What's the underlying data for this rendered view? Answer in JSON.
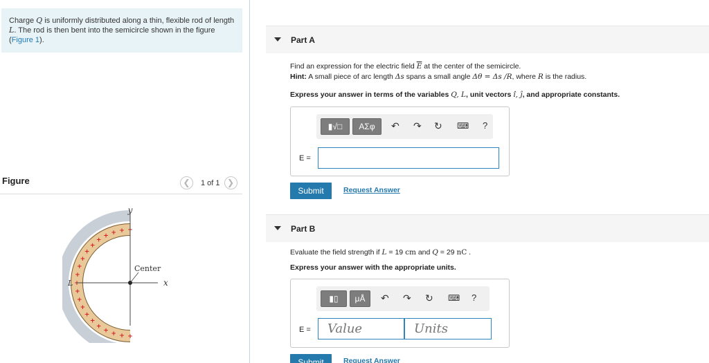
{
  "problem": {
    "intro_pre": "Charge ",
    "intro_Q": "Q",
    "intro_mid1": " is uniformly distributed along a thin, flexible rod of length ",
    "intro_L": "L",
    "intro_mid2": ". The rod is then bent into the semicircle shown in the figure (",
    "intro_link": "Figure 1",
    "intro_post": ")."
  },
  "figure": {
    "title": "Figure",
    "counter": "1 of 1",
    "prev_icon": "chevron-left-icon",
    "next_icon": "chevron-right-icon",
    "labels": {
      "y": "y",
      "x": "x",
      "L": "L",
      "center": "Center"
    },
    "colors": {
      "rod_fill": "#e9c99a",
      "rod_ring": "#c9cfd6",
      "charge_sign": "#d42020"
    }
  },
  "part_a": {
    "label": "Part A",
    "q1_pre": "Find an expression for the electric field ",
    "q1_E": "E",
    "q1_post": " at the center of the semicircle.",
    "hint_label": "Hint:",
    "hint_t1": " A small piece of arc length ",
    "hint_ds": "Δs",
    "hint_t2": " spans a small angle ",
    "hint_dtheta": "Δθ = Δs /R",
    "hint_t3": ", where ",
    "hint_R": "R",
    "hint_t4": " is the radius.",
    "express_pre": "Express your answer in terms of the variables ",
    "express_vars": "Q, L",
    "express_mid": ", unit vectors ",
    "express_units": "î, ĵ",
    "express_post": ", and appropriate constants.",
    "toolbar": {
      "template_icon": "▮√□",
      "greek": "ΑΣφ",
      "help": "?"
    },
    "answer_label": "E =",
    "answer_value": "",
    "submit": "Submit",
    "request": "Request Answer"
  },
  "part_b": {
    "label": "Part B",
    "q_pre": "Evaluate the field strength if ",
    "q_L": "L",
    "q_Lval": " = 19 ",
    "q_Lunit": "cm",
    "q_and": " and ",
    "q_Q": "Q",
    "q_Qval": " = 29 ",
    "q_Qunit": "nC",
    "q_post": " .",
    "express": "Express your answer with the appropriate units.",
    "toolbar": {
      "template_icon": "▮▯",
      "units": "μÅ",
      "help": "?"
    },
    "answer_label": "E =",
    "value_placeholder": "Value",
    "units_placeholder": "Units",
    "submit": "Submit",
    "request": "Request Answer"
  },
  "colors": {
    "accent": "#2479ad",
    "intro_bg": "#e8f3f7",
    "link": "#1f7ab5"
  }
}
